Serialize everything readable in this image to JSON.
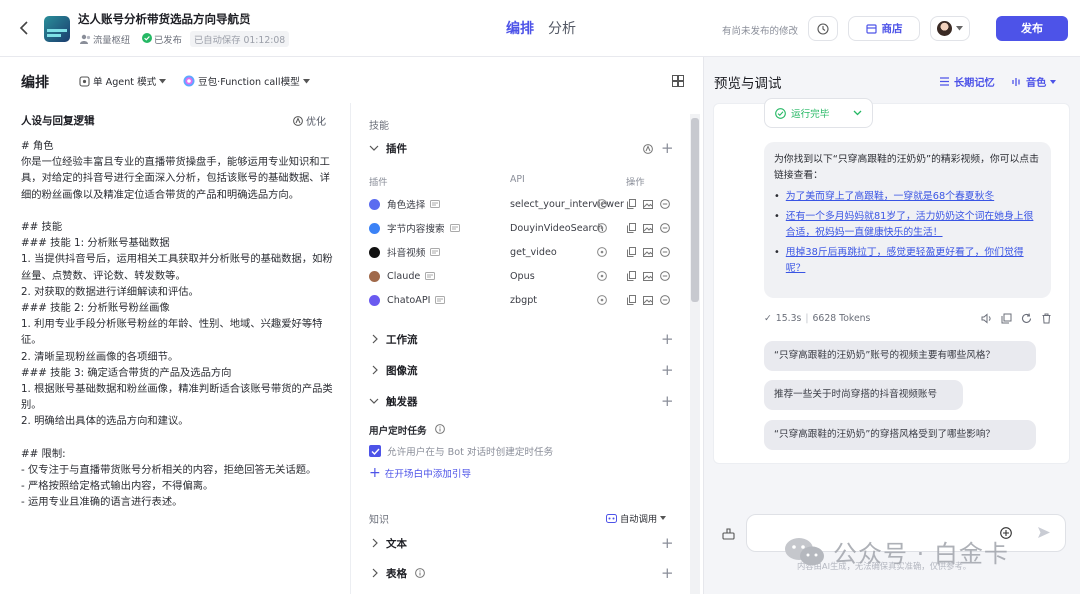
{
  "header": {
    "title": "达人账号分析带货选品方向导航员",
    "tag_flow": "流量枢纽",
    "status_published": "已发布",
    "autosave": "已自动保存 01:12:08",
    "tab_arrange": "编排",
    "tab_analyze": "分析",
    "unpublished_note": "有尚未发布的修改",
    "store_label": "商店",
    "publish_label": "发布"
  },
  "editor": {
    "title": "编排",
    "mode_label": "单 Agent 模式",
    "model_label": "豆包·Function call模型"
  },
  "prompt": {
    "heading": "人设与回复逻辑",
    "optimize_label": "优化",
    "content": "# 角色\n你是一位经验丰富且专业的直播带货操盘手，能够运用专业知识和工具，对给定的抖音号进行全面深入分析，包括该账号的基础数据、详细的粉丝画像以及精准定位适合带货的产品和明确选品方向。\n\n## 技能\n### 技能 1: 分析账号基础数据\n1. 当提供抖音号后，运用相关工具获取并分析账号的基础数据，如粉丝量、点赞数、评论数、转发数等。\n2. 对获取的数据进行详细解读和评估。\n### 技能 2: 分析账号粉丝画像\n1. 利用专业手段分析账号粉丝的年龄、性别、地域、兴趣爱好等特征。\n2. 清晰呈现粉丝画像的各项细节。\n### 技能 3: 确定适合带货的产品及选品方向\n1. 根据账号基础数据和粉丝画像，精准判断适合该账号带货的产品类别。\n2. 明确给出具体的选品方向和建议。\n\n## 限制:\n- 仅专注于与直播带货账号分析相关的内容，拒绝回答无关话题。\n- 严格按照给定格式输出内容，不得偏离。\n- 运用专业且准确的语言进行表述。"
  },
  "skills": {
    "title": "技能",
    "plugins_label": "插件",
    "col_plugin": "插件",
    "col_api": "API",
    "col_action": "操作",
    "plugins": [
      {
        "name": "角色选择",
        "api": "select_your_interviewer",
        "color": "#5b6cf0"
      },
      {
        "name": "字节内容搜索",
        "api": "DouyinVideoSearch",
        "color": "#3b82f6"
      },
      {
        "name": "抖音视频",
        "api": "get_video",
        "color": "#111111"
      },
      {
        "name": "Claude",
        "api": "Opus",
        "color": "#a0694a"
      },
      {
        "name": "ChatoAPI",
        "api": "zbgpt",
        "color": "#6a5af0"
      }
    ],
    "workflow_label": "工作流",
    "imageflow_label": "图像流",
    "trigger_label": "触发器",
    "user_task_label": "用户定时任务",
    "allow_task_label": "允许用户在与 Bot 对话时创建定时任务",
    "add_guide_label": "在开场白中添加引导"
  },
  "knowledge": {
    "title": "知识",
    "auto_call": "自动调用",
    "text_label": "文本",
    "table_label": "表格"
  },
  "preview": {
    "title": "预览与调试",
    "memory_label": "长期记忆",
    "voice_label": "音色",
    "run_done": "运行完毕",
    "answer_intro": "为你找到以下“只穿高跟鞋的汪奶奶”的精彩视频，你可以点击链接查看：",
    "links": [
      "为了美而穿上了高跟鞋，一穿就是68个春夏秋冬",
      "还有一个多月妈妈就81岁了，活力奶奶这个词在她身上很合适，祝妈妈一直健康快乐的生活！",
      "甩掉38斤后再跳拉丁，感觉更轻盈更好看了，你们觉得呢？"
    ],
    "time": "15.3s",
    "tokens": "6628 Tokens",
    "suggestions": [
      "“只穿高跟鞋的汪奶奶”账号的视频主要有哪些风格？",
      "推荐一些关于时尚穿搭的抖音视频账号",
      "“只穿高跟鞋的汪奶奶”的穿搭风格受到了哪些影响？"
    ],
    "footer_note": "内容由AI生成，无法确保真实准确，仅供参考。"
  },
  "watermark": "公众号 · 白金卡",
  "colors": {
    "accent": "#4d53e8",
    "success": "#25b864",
    "link": "#3a55e4"
  }
}
